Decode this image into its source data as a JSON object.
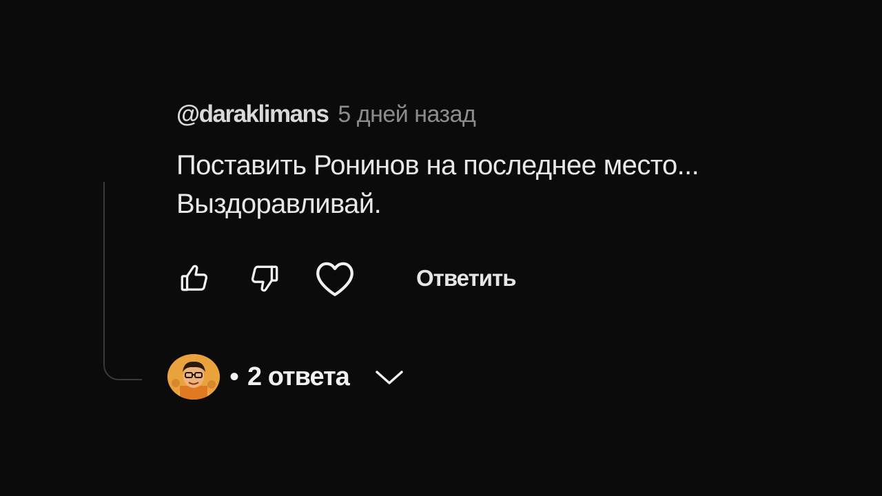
{
  "comment": {
    "author": "@daraklimans",
    "time": "5 дней назад",
    "text_line1": "Поставить Ронинов на последнее место...",
    "text_line2": "Выздоравливай."
  },
  "actions": {
    "like_icon": "thumb-up-icon",
    "dislike_icon": "thumb-down-icon",
    "heart_icon": "heart-icon",
    "reply_label": "Ответить"
  },
  "replies": {
    "bullet": "•",
    "count_label": "2 ответа",
    "avatar_icon": "avatar",
    "expand_icon": "chevron-down-icon"
  },
  "colors": {
    "background": "#0b0b0b",
    "text": "#e8e8e8",
    "muted": "#8c8c8c",
    "thread_line": "#3a3a3a"
  }
}
